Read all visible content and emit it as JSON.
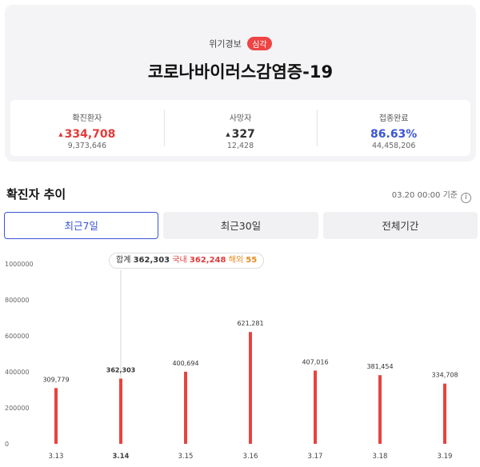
{
  "header": {
    "alert_label": "위기경보",
    "alert_level": "심각",
    "title": "코로나바이러스감염증-19"
  },
  "stats": [
    {
      "label": "확진환자",
      "arrow": "▲",
      "main": "334,708",
      "sub": "9,373,646",
      "tone": "red"
    },
    {
      "label": "사망자",
      "arrow": "▲",
      "main": "327",
      "sub": "12,428",
      "tone": "dark"
    },
    {
      "label": "접종완료",
      "arrow": "",
      "main": "86.63%",
      "sub": "44,458,206",
      "tone": "blue"
    }
  ],
  "section": {
    "title": "확진자 추이",
    "basis": "03.20 00:00 기준",
    "info_icon": "info-icon"
  },
  "tabs": [
    {
      "label": "최근7일",
      "active": true
    },
    {
      "label": "최근30일",
      "active": false
    },
    {
      "label": "전체기간",
      "active": false
    }
  ],
  "tooltip": {
    "total_label": "합계",
    "total": "362,303",
    "domestic_label": "국내",
    "domestic": "362,248",
    "foreign_label": "해외",
    "foreign": "55"
  },
  "chart_data": {
    "type": "bar",
    "categories": [
      "3.13",
      "3.14",
      "3.15",
      "3.16",
      "3.17",
      "3.18",
      "3.19"
    ],
    "values": [
      309779,
      362303,
      400694,
      621281,
      407016,
      381454,
      334708
    ],
    "value_labels": [
      "309,779",
      "362,303",
      "400,694",
      "621,281",
      "407,016",
      "381,454",
      "334,708"
    ],
    "highlight_index": 1,
    "ylim": [
      0,
      1000000
    ],
    "yticks": [
      0,
      200000,
      400000,
      600000,
      800000,
      1000000
    ],
    "ytick_labels": [
      "0",
      "200000",
      "400000",
      "600000",
      "800000",
      "1000000"
    ],
    "bar_color": "#e8433f",
    "title": "",
    "xlabel": "",
    "ylabel": "",
    "grid": false
  }
}
